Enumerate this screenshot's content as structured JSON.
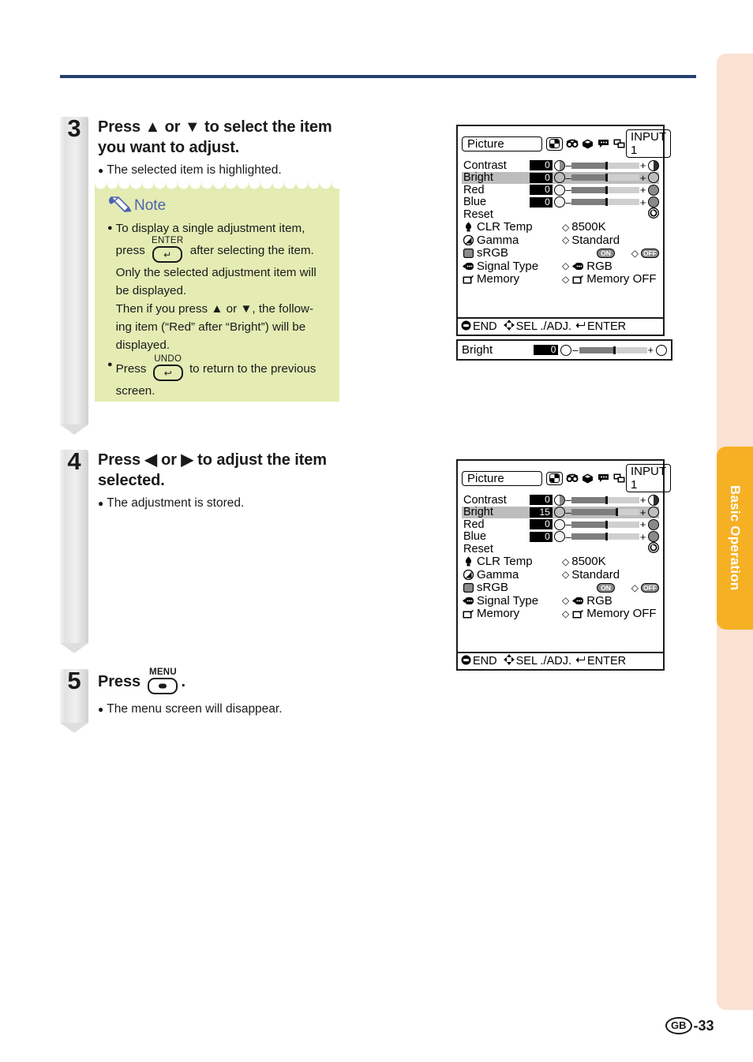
{
  "page": {
    "footer_region": "GB",
    "footer_page": "-33",
    "side_tab_label": "Basic Operation"
  },
  "steps": [
    {
      "number": "3",
      "title_line1": "Press ▲ or ▼ to select the item",
      "title_line2": "you want to adjust.",
      "bullet": "The selected item is highlighted."
    },
    {
      "number": "4",
      "title_line1": "Press ◀ or ▶ to adjust the item",
      "title_line2": "selected.",
      "bullet": "The adjustment is stored."
    },
    {
      "number": "5",
      "title_prefix": "Press",
      "title_suffix": ".",
      "key_label": "MENU",
      "key_glyph": "■",
      "bullet": "The menu screen will disappear."
    }
  ],
  "note": {
    "title": "Note",
    "items": [
      {
        "pre": "To display a single adjustment item,",
        "line2_pre": "press",
        "key_label": "ENTER",
        "key_glyph": "↵",
        "line2_post": "after selecting the item.",
        "line3": "Only the selected adjustment item will",
        "line4": "be displayed.",
        "line5": "Then if you press ▲ or ▼, the follow-",
        "line6": "ing item (“Red” after “Bright”) will be",
        "line7": "displayed."
      },
      {
        "pre": "Press",
        "key_label": "UNDO",
        "key_glyph": "↩",
        "post": "to return to the previous",
        "line2": "screen."
      }
    ]
  },
  "osd_menus": [
    {
      "id": "menu-step3",
      "title": "Picture",
      "input": "INPUT  1",
      "tabs": [
        "picture-icon",
        "audio-icon",
        "options-icon",
        "language-icon",
        "prj-mode-icon"
      ],
      "selected_tab": 0,
      "slider_rows": [
        {
          "label": "Contrast",
          "value": "0",
          "fill_pct": 50,
          "knob_pct": 50,
          "highlighted": false
        },
        {
          "label": "Bright",
          "value": "0",
          "fill_pct": 50,
          "knob_pct": 50,
          "highlighted": true
        },
        {
          "label": "Red",
          "value": "0",
          "fill_pct": 50,
          "knob_pct": 50,
          "highlighted": false
        },
        {
          "label": "Blue",
          "value": "0",
          "fill_pct": 50,
          "knob_pct": 50,
          "highlighted": false
        }
      ],
      "reset_label": "Reset",
      "option_rows": [
        {
          "icon": "lamp-icon",
          "label": "CLR Temp",
          "marker": "◇",
          "value": "8500K"
        },
        {
          "icon": "gamma-icon",
          "label": "Gamma",
          "marker": "◇",
          "value": "Standard"
        },
        {
          "icon": "srgb-icon",
          "label": "sRGB",
          "toggle_on": "ON",
          "toggle_off": "OFF",
          "marker": "◇"
        },
        {
          "icon": "signal-type-icon",
          "label": "Signal Type",
          "marker": "◇",
          "value": "RGB"
        },
        {
          "icon": "memory-icon",
          "label": "Memory",
          "marker": "◇",
          "value": "Memory OFF"
        }
      ],
      "status": {
        "end": "END",
        "sel": "SEL ./ADJ.",
        "enter": "ENTER"
      }
    },
    {
      "id": "menu-step4",
      "title": "Picture",
      "input": "INPUT  1",
      "tabs": [
        "picture-icon",
        "audio-icon",
        "options-icon",
        "language-icon",
        "prj-mode-icon"
      ],
      "selected_tab": 0,
      "slider_rows": [
        {
          "label": "Contrast",
          "value": "0",
          "fill_pct": 50,
          "knob_pct": 50,
          "highlighted": false
        },
        {
          "label": "Bright",
          "value": "15",
          "fill_pct": 65,
          "knob_pct": 65,
          "highlighted": true
        },
        {
          "label": "Red",
          "value": "0",
          "fill_pct": 50,
          "knob_pct": 50,
          "highlighted": false
        },
        {
          "label": "Blue",
          "value": "0",
          "fill_pct": 50,
          "knob_pct": 50,
          "highlighted": false
        }
      ],
      "reset_label": "Reset",
      "option_rows": [
        {
          "icon": "lamp-icon",
          "label": "CLR Temp",
          "marker": "◇",
          "value": "8500K"
        },
        {
          "icon": "gamma-icon",
          "label": "Gamma",
          "marker": "◇",
          "value": "Standard"
        },
        {
          "icon": "srgb-icon",
          "label": "sRGB",
          "toggle_on": "ON",
          "toggle_off": "OFF",
          "marker": "◇"
        },
        {
          "icon": "signal-type-icon",
          "label": "Signal Type",
          "marker": "◇",
          "value": "RGB"
        },
        {
          "icon": "memory-icon",
          "label": "Memory",
          "marker": "◇",
          "value": "Memory OFF"
        }
      ],
      "status": {
        "end": "END",
        "sel": "SEL ./ADJ.",
        "enter": "ENTER"
      }
    }
  ],
  "osd_single": {
    "label": "Bright",
    "value": "0",
    "fill_pct": 50,
    "knob_pct": 50,
    "minus": "–",
    "plus": "+"
  }
}
